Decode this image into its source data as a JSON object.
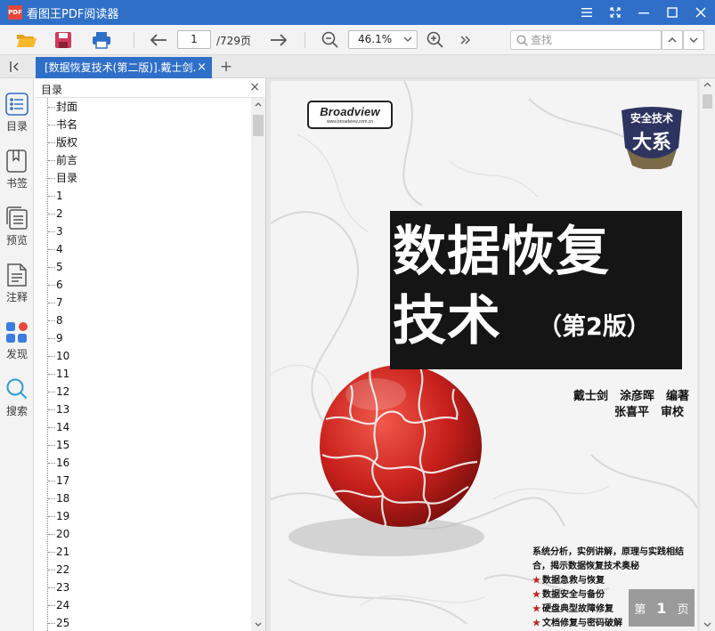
{
  "titlebar": {
    "logo_text": "PDF",
    "title": "看图王PDF阅读器"
  },
  "toolbar": {
    "current_page": "1",
    "total_pages": "/729页",
    "zoom": "46.1%",
    "search_placeholder": "查找"
  },
  "tabs": {
    "active_tab": "[数据恢复技术(第二版)].戴士剑.涂彦晖编著.扫描版.pdf",
    "close": "×",
    "add": "+"
  },
  "rail": {
    "items": [
      {
        "label": "目录",
        "icon": "list-icon"
      },
      {
        "label": "书签",
        "icon": "bookmark-icon"
      },
      {
        "label": "预览",
        "icon": "pages-icon"
      },
      {
        "label": "注释",
        "icon": "note-icon"
      },
      {
        "label": "发现",
        "icon": "apps-icon"
      },
      {
        "label": "搜索",
        "icon": "search-icon"
      }
    ]
  },
  "outline": {
    "title": "目录",
    "close": "×",
    "items": [
      "封面",
      "书名",
      "版权",
      "前言",
      "目录",
      "1",
      "2",
      "3",
      "4",
      "5",
      "6",
      "7",
      "8",
      "9",
      "10",
      "11",
      "12",
      "13",
      "14",
      "15",
      "16",
      "17",
      "18",
      "19",
      "20",
      "21",
      "22",
      "23",
      "24",
      "25"
    ]
  },
  "cover": {
    "publisher_logo": "Broadview",
    "publisher_url": "www.broadview.com.cn",
    "series_line1": "安全技术",
    "series_line2": "大系",
    "title_line1": "数据恢复",
    "title_line2": "技术",
    "edition": "（第2版）",
    "authors": "戴士剑　涂彦晖　编著",
    "reviewers": "张喜平　审校",
    "blurb_intro": "系统分析，实例讲解，原理与实践相结合，揭示数据恢复技术奥秘",
    "bullets": [
      "数据急救与恢复",
      "数据安全与备份",
      "硬盘典型故障修复",
      "文档修复与密码破解"
    ]
  },
  "page_badge": {
    "prefix": "第",
    "number": "1",
    "suffix": "页"
  },
  "colors": {
    "accent": "#2f6fc8",
    "title_block": "#151515",
    "puzzle_red": "#c8201c"
  }
}
